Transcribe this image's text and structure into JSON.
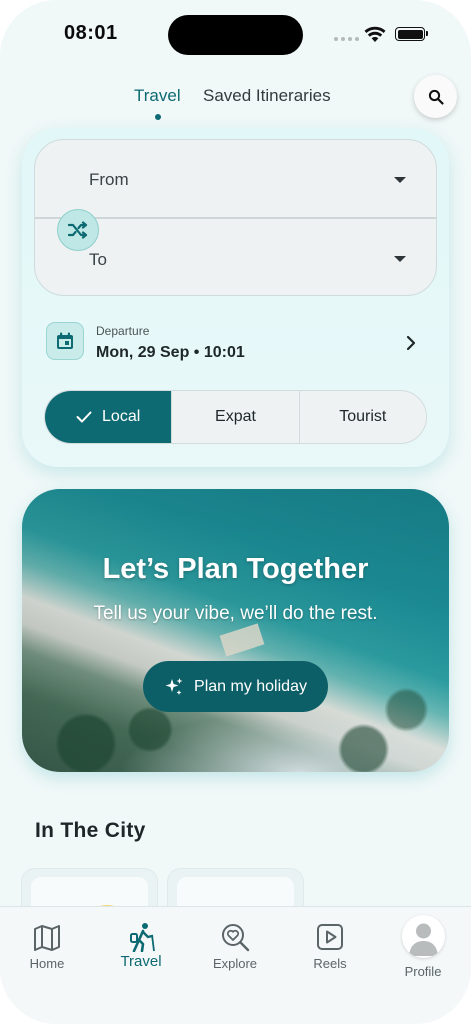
{
  "status_bar": {
    "time": "08:01"
  },
  "tabs": [
    {
      "label": "Travel",
      "active": true
    },
    {
      "label": "Saved Itineraries",
      "active": false
    }
  ],
  "search": {
    "icon": "search-icon"
  },
  "route": {
    "from_placeholder": "From",
    "to_placeholder": "To",
    "swap_icon": "shuffle-icon"
  },
  "departure": {
    "label": "Departure",
    "value": "Mon, 29 Sep • 10:01"
  },
  "traveler_type": {
    "options": [
      {
        "label": "Local",
        "selected": true
      },
      {
        "label": "Expat",
        "selected": false
      },
      {
        "label": "Tourist",
        "selected": false
      }
    ]
  },
  "hero": {
    "title": "Let’s Plan Together",
    "subtitle": "Tell us your vibe, we’ll do the rest.",
    "button_label": "Plan my holiday"
  },
  "city_section": {
    "title": "In The City"
  },
  "bottom_nav": [
    {
      "label": "Home",
      "icon": "map-icon",
      "active": false
    },
    {
      "label": "Travel",
      "icon": "hiker-icon",
      "active": true
    },
    {
      "label": "Explore",
      "icon": "explore-heart-search-icon",
      "active": false
    },
    {
      "label": "Reels",
      "icon": "play-icon",
      "active": false
    },
    {
      "label": "Profile",
      "icon": "avatar-icon",
      "active": false
    }
  ],
  "colors": {
    "accent": "#0d6a72",
    "background": "#f1f8f8",
    "card": "#e4f7f8"
  }
}
